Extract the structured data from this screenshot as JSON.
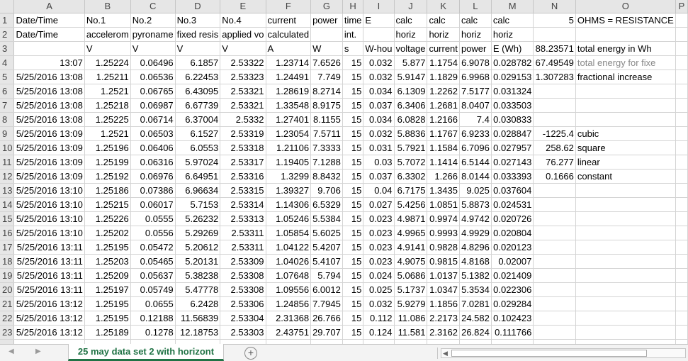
{
  "columns": [
    "A",
    "B",
    "C",
    "D",
    "E",
    "F",
    "G",
    "H",
    "I",
    "J",
    "K",
    "L",
    "M",
    "N",
    "O",
    "P"
  ],
  "rows": [
    {
      "n": "1",
      "c": [
        "Date/Time",
        "No.1",
        "No.2",
        "No.3",
        "No.4",
        "current",
        "power",
        "time",
        "E",
        "calc",
        "calc",
        "calc",
        "calc",
        "5",
        "OHMS = RESISTANCE",
        ""
      ]
    },
    {
      "n": "2",
      "c": [
        "Date/Time",
        "accelerom",
        "pyroname",
        "fixed resis",
        "applied vo",
        "calculated",
        "",
        "int.",
        "",
        "horiz",
        "horiz",
        "horiz",
        "horiz",
        "",
        "",
        ""
      ]
    },
    {
      "n": "3",
      "c": [
        "",
        "V",
        "V",
        "V",
        "V",
        "A",
        "W",
        "s",
        "W-hou",
        "voltage",
        "current",
        "power",
        "E (Wh)",
        "88.23571",
        "total energy in Wh",
        ""
      ]
    },
    {
      "n": "4",
      "c": [
        "13:07",
        "1.25224",
        "0.06496",
        "6.1857",
        "2.53322",
        "1.23714",
        "7.6526",
        "15",
        "0.032",
        "5.877",
        "1.1754",
        "6.9078",
        "0.028782",
        "67.49549",
        "total energy for fixe",
        ""
      ]
    },
    {
      "n": "5",
      "c": [
        "5/25/2016 13:08",
        "1.25211",
        "0.06536",
        "6.22453",
        "2.53323",
        "1.24491",
        "7.749",
        "15",
        "0.032",
        "5.9147",
        "1.1829",
        "6.9968",
        "0.029153",
        "1.307283",
        "fractional increase",
        ""
      ]
    },
    {
      "n": "6",
      "c": [
        "5/25/2016 13:08",
        "1.2521",
        "0.06765",
        "6.43095",
        "2.53321",
        "1.28619",
        "8.2714",
        "15",
        "0.034",
        "6.1309",
        "1.2262",
        "7.5177",
        "0.031324",
        "",
        "",
        ""
      ]
    },
    {
      "n": "7",
      "c": [
        "5/25/2016 13:08",
        "1.25218",
        "0.06987",
        "6.67739",
        "2.53321",
        "1.33548",
        "8.9175",
        "15",
        "0.037",
        "6.3406",
        "1.2681",
        "8.0407",
        "0.033503",
        "",
        "",
        ""
      ]
    },
    {
      "n": "8",
      "c": [
        "5/25/2016 13:08",
        "1.25225",
        "0.06714",
        "6.37004",
        "2.5332",
        "1.27401",
        "8.1155",
        "15",
        "0.034",
        "6.0828",
        "1.2166",
        "7.4",
        "0.030833",
        "",
        "",
        ""
      ]
    },
    {
      "n": "9",
      "c": [
        "5/25/2016 13:09",
        "1.2521",
        "0.06503",
        "6.1527",
        "2.53319",
        "1.23054",
        "7.5711",
        "15",
        "0.032",
        "5.8836",
        "1.1767",
        "6.9233",
        "0.028847",
        "-1225.4",
        "cubic",
        ""
      ]
    },
    {
      "n": "10",
      "c": [
        "5/25/2016 13:09",
        "1.25196",
        "0.06406",
        "6.0553",
        "2.53318",
        "1.21106",
        "7.3333",
        "15",
        "0.031",
        "5.7921",
        "1.1584",
        "6.7096",
        "0.027957",
        "258.62",
        "square",
        ""
      ]
    },
    {
      "n": "11",
      "c": [
        "5/25/2016 13:09",
        "1.25199",
        "0.06316",
        "5.97024",
        "2.53317",
        "1.19405",
        "7.1288",
        "15",
        "0.03",
        "5.7072",
        "1.1414",
        "6.5144",
        "0.027143",
        "76.277",
        "linear",
        ""
      ]
    },
    {
      "n": "12",
      "c": [
        "5/25/2016 13:09",
        "1.25192",
        "0.06976",
        "6.64951",
        "2.53316",
        "1.3299",
        "8.8432",
        "15",
        "0.037",
        "6.3302",
        "1.266",
        "8.0144",
        "0.033393",
        "0.1666",
        "constant",
        ""
      ]
    },
    {
      "n": "13",
      "c": [
        "5/25/2016 13:10",
        "1.25186",
        "0.07386",
        "6.96634",
        "2.53315",
        "1.39327",
        "9.706",
        "15",
        "0.04",
        "6.7175",
        "1.3435",
        "9.025",
        "0.037604",
        "",
        "",
        ""
      ]
    },
    {
      "n": "14",
      "c": [
        "5/25/2016 13:10",
        "1.25215",
        "0.06017",
        "5.7153",
        "2.53314",
        "1.14306",
        "6.5329",
        "15",
        "0.027",
        "5.4256",
        "1.0851",
        "5.8873",
        "0.024531",
        "",
        "",
        ""
      ]
    },
    {
      "n": "15",
      "c": [
        "5/25/2016 13:10",
        "1.25226",
        "0.0555",
        "5.26232",
        "2.53313",
        "1.05246",
        "5.5384",
        "15",
        "0.023",
        "4.9871",
        "0.9974",
        "4.9742",
        "0.020726",
        "",
        "",
        ""
      ]
    },
    {
      "n": "16",
      "c": [
        "5/25/2016 13:10",
        "1.25202",
        "0.0556",
        "5.29269",
        "2.53311",
        "1.05854",
        "5.6025",
        "15",
        "0.023",
        "4.9965",
        "0.9993",
        "4.9929",
        "0.020804",
        "",
        "",
        ""
      ]
    },
    {
      "n": "17",
      "c": [
        "5/25/2016 13:11",
        "1.25195",
        "0.05472",
        "5.20612",
        "2.53311",
        "1.04122",
        "5.4207",
        "15",
        "0.023",
        "4.9141",
        "0.9828",
        "4.8296",
        "0.020123",
        "",
        "",
        ""
      ]
    },
    {
      "n": "18",
      "c": [
        "5/25/2016 13:11",
        "1.25203",
        "0.05465",
        "5.20131",
        "2.53309",
        "1.04026",
        "5.4107",
        "15",
        "0.023",
        "4.9075",
        "0.9815",
        "4.8168",
        "0.02007",
        "",
        "",
        ""
      ]
    },
    {
      "n": "19",
      "c": [
        "5/25/2016 13:11",
        "1.25209",
        "0.05637",
        "5.38238",
        "2.53308",
        "1.07648",
        "5.794",
        "15",
        "0.024",
        "5.0686",
        "1.0137",
        "5.1382",
        "0.021409",
        "",
        "",
        ""
      ]
    },
    {
      "n": "20",
      "c": [
        "5/25/2016 13:11",
        "1.25197",
        "0.05749",
        "5.47778",
        "2.53308",
        "1.09556",
        "6.0012",
        "15",
        "0.025",
        "5.1737",
        "1.0347",
        "5.3534",
        "0.022306",
        "",
        "",
        ""
      ]
    },
    {
      "n": "21",
      "c": [
        "5/25/2016 13:12",
        "1.25195",
        "0.0655",
        "6.2428",
        "2.53306",
        "1.24856",
        "7.7945",
        "15",
        "0.032",
        "5.9279",
        "1.1856",
        "7.0281",
        "0.029284",
        "",
        "",
        ""
      ]
    },
    {
      "n": "22",
      "c": [
        "5/25/2016 13:12",
        "1.25195",
        "0.12188",
        "11.56839",
        "2.53304",
        "2.31368",
        "26.766",
        "15",
        "0.112",
        "11.086",
        "2.2173",
        "24.582",
        "0.102423",
        "",
        "",
        ""
      ]
    },
    {
      "n": "23",
      "c": [
        "5/25/2016 13:12",
        "1.25189",
        "0.1278",
        "12.18753",
        "2.53303",
        "2.43751",
        "29.707",
        "15",
        "0.124",
        "11.581",
        "2.3162",
        "26.824",
        "0.111766",
        "",
        "",
        ""
      ]
    }
  ],
  "sheet_tab": "25 may data set 2 with horizont",
  "add_sheet_label": "+",
  "nav_prev": "◀",
  "nav_next": "▶"
}
